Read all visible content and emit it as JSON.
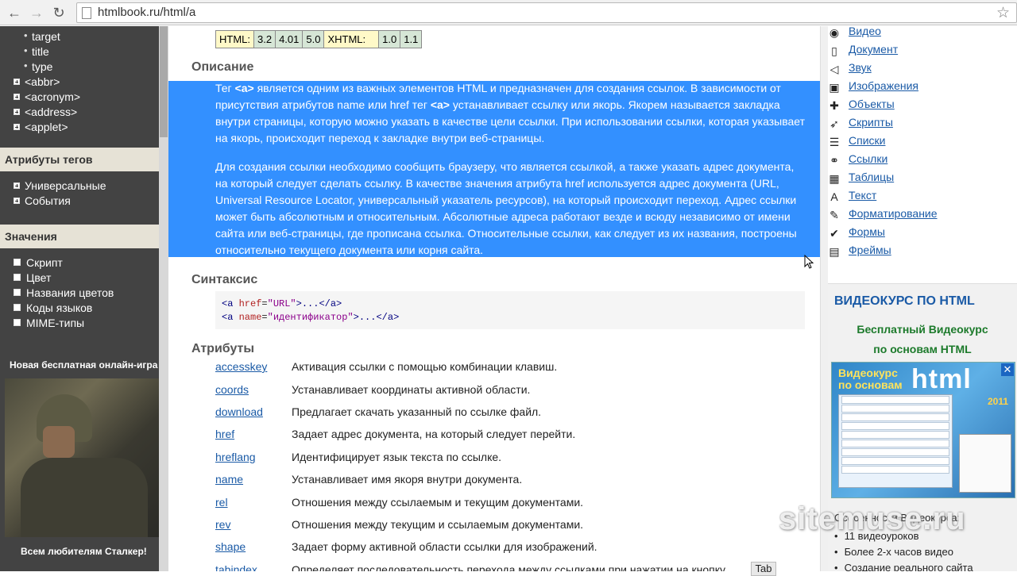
{
  "browser": {
    "url": "htmlbook.ru/html/a"
  },
  "sidebar": {
    "sub_items": [
      "target",
      "title",
      "type"
    ],
    "tree_items": [
      "<abbr>",
      "<acronym>",
      "<address>",
      "<applet>"
    ],
    "section_attrs": {
      "title": "Атрибуты тегов",
      "items": [
        "Универсальные",
        "События"
      ]
    },
    "section_values": {
      "title": "Значения",
      "items": [
        "Скрипт",
        "Цвет",
        "Названия цветов",
        "Коды языков",
        "MIME-типы"
      ]
    },
    "promo_title": "Новая бесплатная онлайн-игра ...",
    "promo_caption": "Всем любителям Сталкер!"
  },
  "main": {
    "versions": {
      "html_label": "HTML:",
      "html": [
        "3.2",
        "4.01",
        "5.0"
      ],
      "xhtml_label": "XHTML:",
      "xhtml": [
        "1.0",
        "1.1"
      ]
    },
    "description_title": "Описание",
    "p1": {
      "pre": "Тег ",
      "tag1": "<a>",
      "mid": " является одним из важных элементов HTML и предназначен для создания ссылок. В зависимости от присутствия атрибутов name или href тег ",
      "tag2": "<a>",
      "post": " устанавливает ссылку или якорь. Якорем называется закладка внутри страницы, которую можно указать в качестве цели ссылки. При использовании ссылки, которая указывает на якорь, происходит переход к закладке внутри веб-страницы."
    },
    "p2": "Для создания ссылки необходимо сообщить браузеру, что является ссылкой, а также указать адрес документа, на который следует сделать ссылку. В качестве значения атрибута href используется адрес документа (URL, Universal Resource Locator, универсальный указатель ресурсов), на который происходит переход. Адрес ссылки может быть абсолютным и относительным. Абсолютные адреса работают везде и всюду независимо от имени сайта или веб-страницы, где прописана ссылка. Относительные ссылки, как следует из их названия, построены относительно текущего документа или корня сайта.",
    "syntax_title": "Синтаксис",
    "syntax": {
      "l1_open": "<a ",
      "l1_attr": "href",
      "l1_eq": "=",
      "l1_val": "\"URL\"",
      "l1_rest": ">...</a>",
      "l2_open": "<a ",
      "l2_attr": "name",
      "l2_eq": "=",
      "l2_val": "\"идентификатор\"",
      "l2_rest": ">...</a>"
    },
    "attributes_title": "Атрибуты",
    "attributes": [
      {
        "name": "accesskey",
        "desc": "Активация ссылки с помощью комбинации клавиш."
      },
      {
        "name": "coords",
        "desc": "Устанавливает координаты активной области."
      },
      {
        "name": "download",
        "desc": "Предлагает скачать указанный по ссылке файл."
      },
      {
        "name": "href",
        "desc": "Задает адрес документа, на который следует перейти."
      },
      {
        "name": "hreflang",
        "desc": "Идентифицирует язык текста по ссылке."
      },
      {
        "name": "name",
        "desc": "Устанавливает имя якоря внутри документа."
      },
      {
        "name": "rel",
        "desc": "Отношения между ссылаемым и текущим документами."
      },
      {
        "name": "rev",
        "desc": "Отношения между текущим и ссылаемым документами."
      },
      {
        "name": "shape",
        "desc": "Задает форму активной области ссылки для изображений."
      },
      {
        "name": "tabindex",
        "desc": "Определяет последовательность перехода между ссылками при нажатии на кнопку"
      }
    ],
    "tab_key": "Tab"
  },
  "right": {
    "items": [
      {
        "label": "Видео",
        "icon": "film-icon"
      },
      {
        "label": "Документ",
        "icon": "document-icon"
      },
      {
        "label": "Звук",
        "icon": "speaker-icon"
      },
      {
        "label": "Изображения",
        "icon": "image-icon"
      },
      {
        "label": "Объекты",
        "icon": "puzzle-icon"
      },
      {
        "label": "Скрипты",
        "icon": "script-icon"
      },
      {
        "label": "Списки",
        "icon": "list-icon"
      },
      {
        "label": "Ссылки",
        "icon": "link-icon"
      },
      {
        "label": "Таблицы",
        "icon": "table-icon"
      },
      {
        "label": "Текст",
        "icon": "text-icon"
      },
      {
        "label": "Форматирование",
        "icon": "brush-icon"
      },
      {
        "label": "Формы",
        "icon": "checkmark-icon"
      },
      {
        "label": "Фреймы",
        "icon": "frame-icon"
      }
    ],
    "course": {
      "header": "ВИДЕОКУРС ПО HTML",
      "line1": "Бесплатный Видеокурс",
      "line2": "по основам HTML",
      "cover_title_1": "Видеокурс",
      "cover_title_2": "по основам",
      "cover_html": "html",
      "cover_year": "2011",
      "features_title": "Особенности Видеокурса:",
      "features": [
        "11 видеоуроков",
        "Более 2-х часов видео",
        "Создание реального сайта"
      ]
    },
    "watermark": "sitemuse.ru"
  }
}
